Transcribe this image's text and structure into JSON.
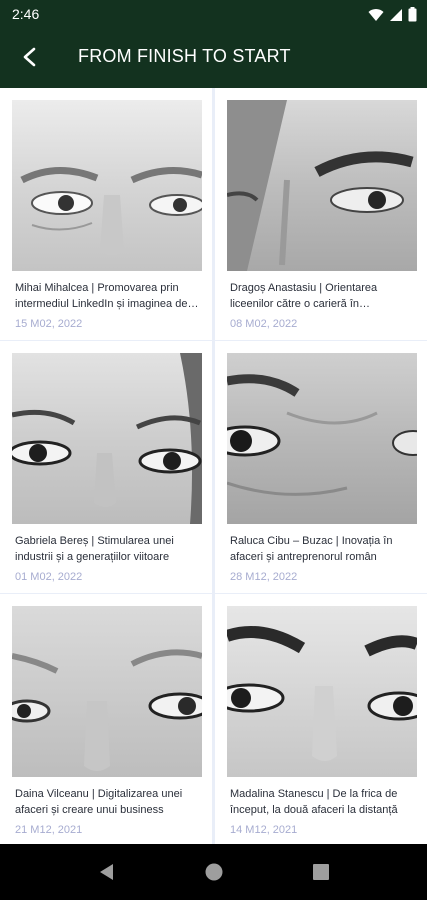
{
  "status": {
    "time": "2:46"
  },
  "header": {
    "title": "FROM FINISH TO START"
  },
  "cards": [
    {
      "title": "Mihai Mihalcea | Promovarea prin intermediul LinkedIn și imaginea de marcă",
      "date": "15 M02, 2022"
    },
    {
      "title": "Dragoș Anastasiu | Orientarea liceenilor către o carieră în antreprenoriat",
      "date": "08 M02, 2022"
    },
    {
      "title": "Gabriela Bereș | Stimularea unei industrii și a generațiilor viitoare",
      "date": "01 M02, 2022"
    },
    {
      "title": "Raluca Cibu – Buzac | Inovația în afaceri și antreprenorul român",
      "date": "28 M12, 2022"
    },
    {
      "title": "Daina Vilceanu | Digitalizarea unei afaceri și creare unui business",
      "date": "21 M12, 2021"
    },
    {
      "title": "Madalina Stanescu | De la frica de început, la două afaceri la distanță",
      "date": "14 M12, 2021"
    }
  ]
}
